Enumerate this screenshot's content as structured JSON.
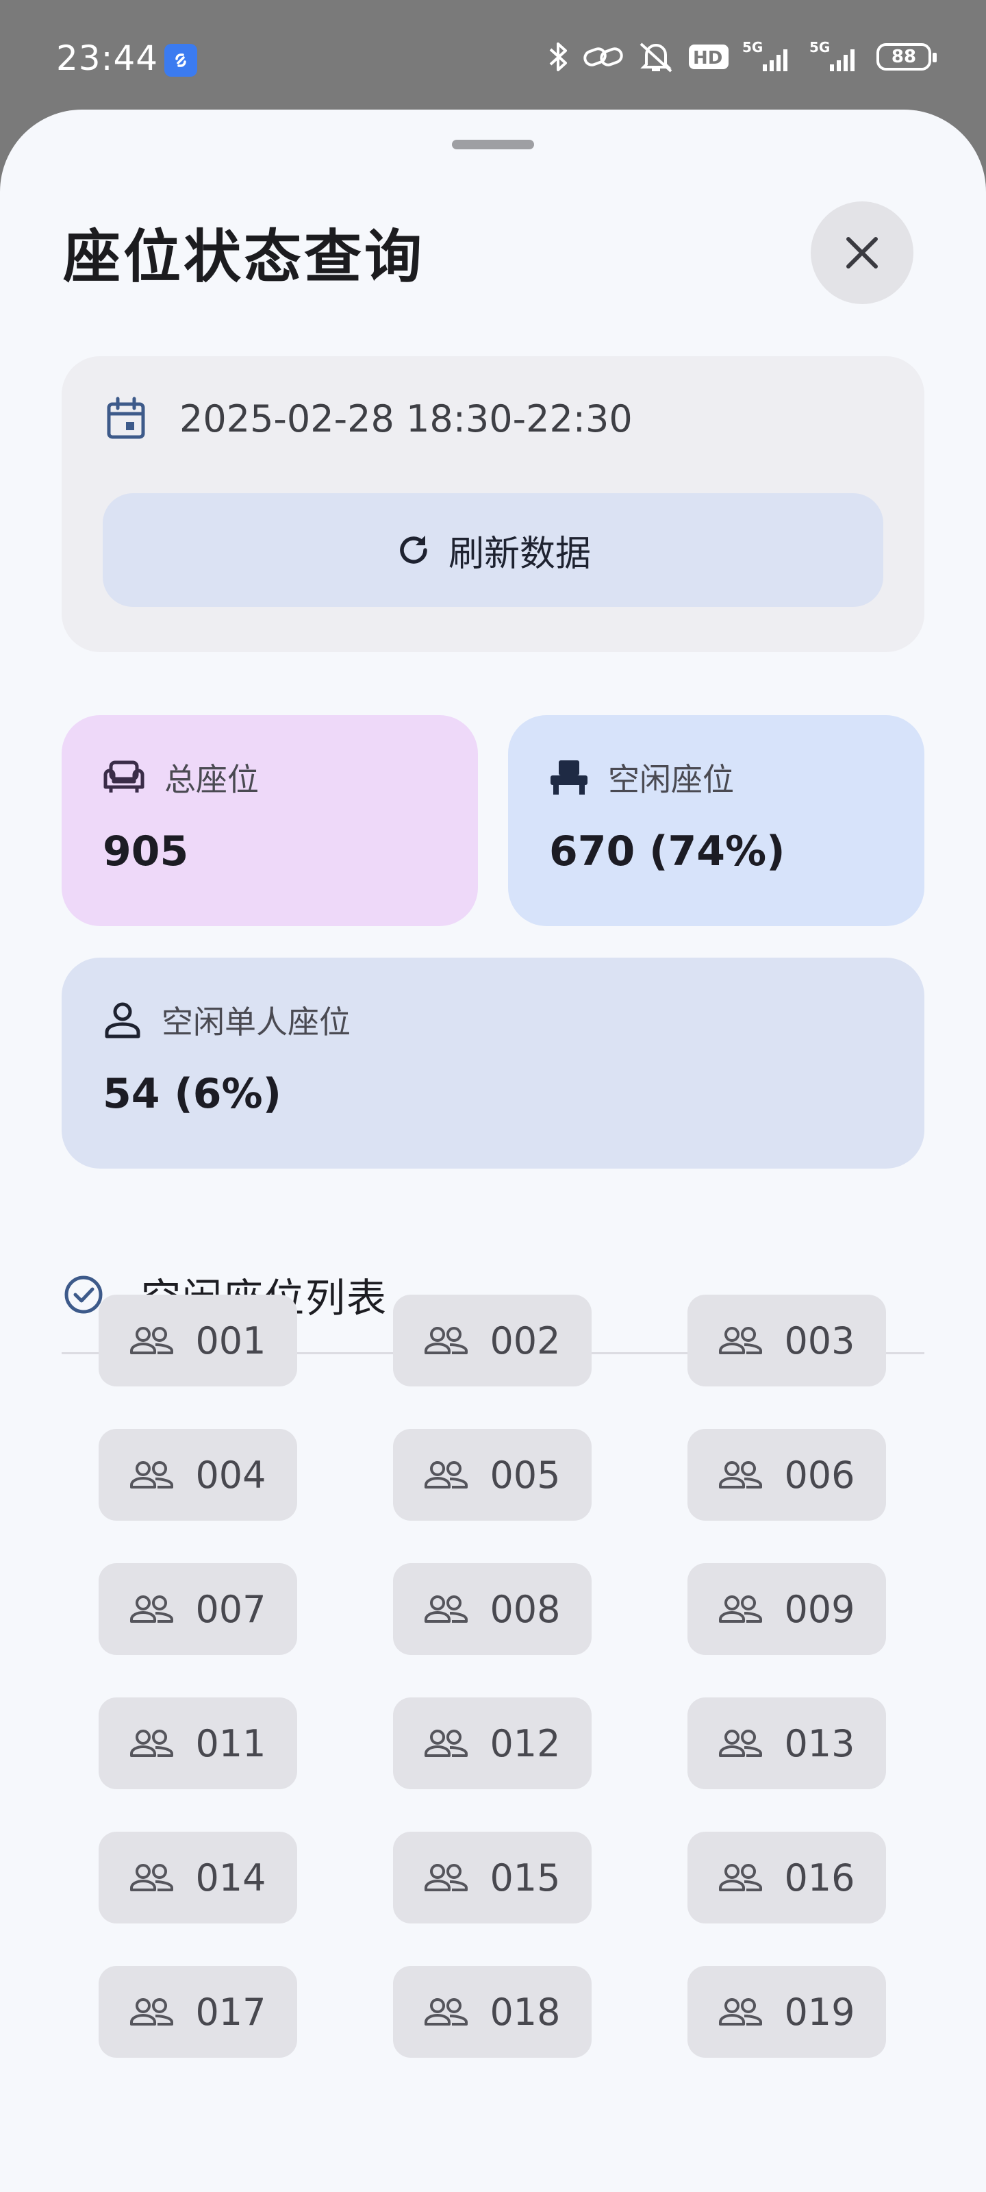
{
  "status_bar": {
    "time": "23:44",
    "battery": "88",
    "icons": [
      "app-icon",
      "bluetooth-icon",
      "link-icon",
      "silent-icon",
      "hd-icon",
      "signal-5g-icon",
      "signal-5g-icon"
    ]
  },
  "sheet": {
    "title": "座位状态查询",
    "close_icon": "close-icon"
  },
  "filter": {
    "datetime": "2025-02-28 18:30-22:30",
    "refresh_label": "刷新数据"
  },
  "stats": {
    "total": {
      "label": "总座位",
      "value": "905",
      "icon": "sofa-icon",
      "color": "#eed9f9"
    },
    "free": {
      "label": "空闲座位",
      "value": "670 (74%)",
      "icon": "chair-icon",
      "color": "#d7e3fa"
    },
    "single": {
      "label": "空闲单人座位",
      "value": "54 (6%)",
      "icon": "person-icon",
      "color": "#dbe2f3"
    }
  },
  "list": {
    "title": "空闲座位列表",
    "seats": [
      "001",
      "002",
      "003",
      "004",
      "005",
      "006",
      "007",
      "008",
      "009",
      "011",
      "012",
      "013",
      "014",
      "015",
      "016",
      "017",
      "018",
      "019"
    ]
  }
}
